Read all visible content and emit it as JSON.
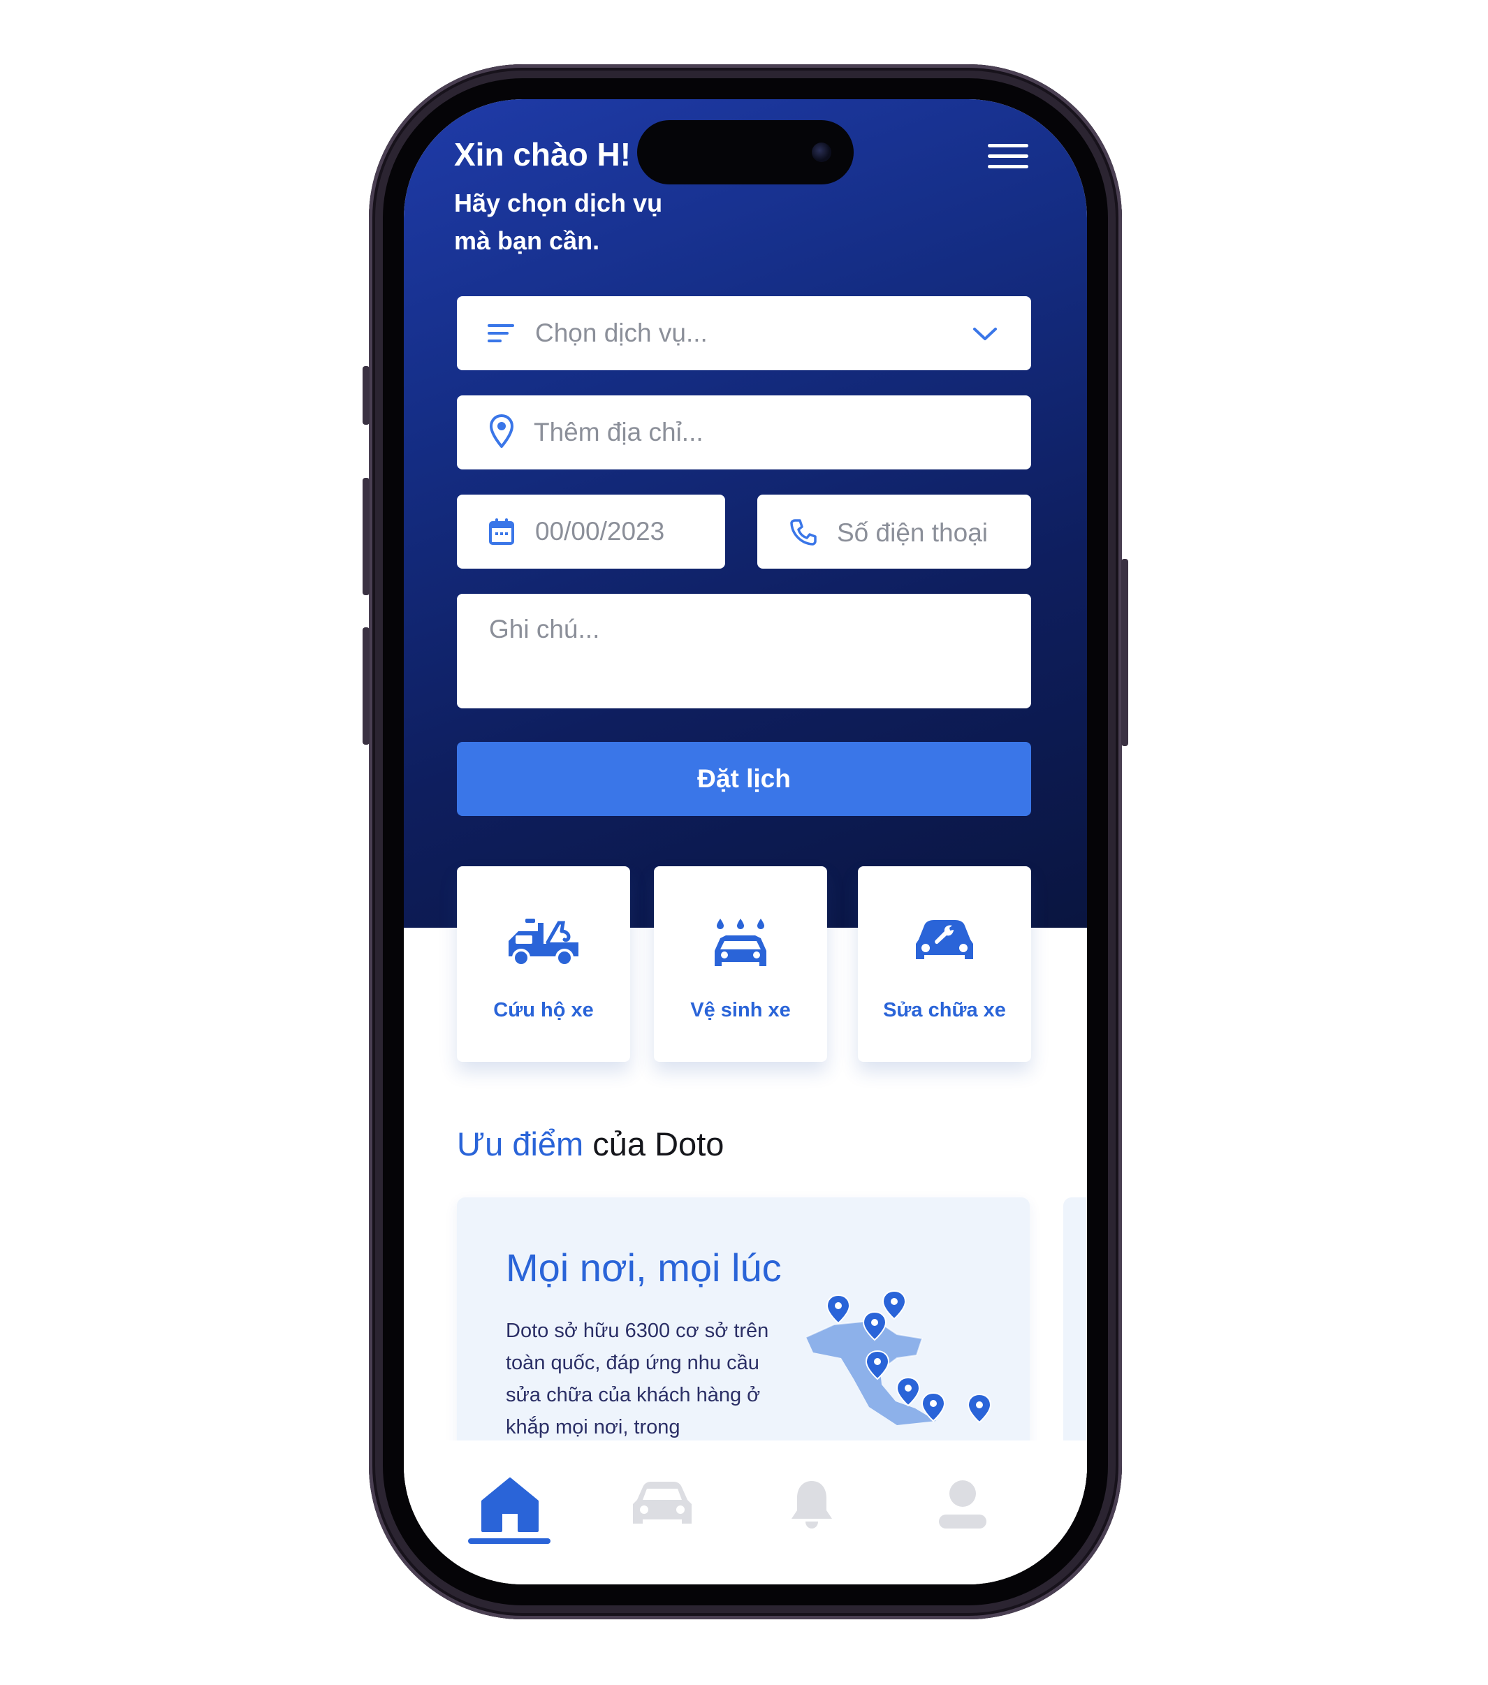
{
  "header": {
    "greeting": "Xin chào H!",
    "subtitle": "Hãy chọn dịch vụ mà bạn cần."
  },
  "form": {
    "service_placeholder": "Chọn dịch vụ...",
    "address_placeholder": "Thêm địa chỉ...",
    "date_placeholder": "00/00/2023",
    "phone_placeholder": "Số điện thoại",
    "note_placeholder": "Ghi chú...",
    "submit_label": "Đặt lịch"
  },
  "services": [
    {
      "label": "Cứu hộ xe",
      "icon": "tow-truck-icon"
    },
    {
      "label": "Vệ sinh xe",
      "icon": "car-wash-icon"
    },
    {
      "label": "Sửa chữa xe",
      "icon": "car-repair-icon"
    }
  ],
  "advantages": {
    "title_highlight": "Ưu điểm",
    "title_rest": " của Doto",
    "card": {
      "title": "Mọi nơi, mọi lúc",
      "description": "Doto sở hữu 6300 cơ sở trên toàn quốc, đáp ứng nhu cầu sửa chữa của khách hàng ở khắp mọi nơi, trong"
    }
  },
  "nav": {
    "active": "home",
    "items": [
      "home-icon",
      "car-icon",
      "bell-icon",
      "profile-icon"
    ]
  },
  "colors": {
    "primary": "#3a76e8",
    "accent_text": "#2a64d8",
    "hero_dark": "#0a1540",
    "hero_light": "#1f3ba8",
    "nav_inactive": "#dcdde2"
  }
}
